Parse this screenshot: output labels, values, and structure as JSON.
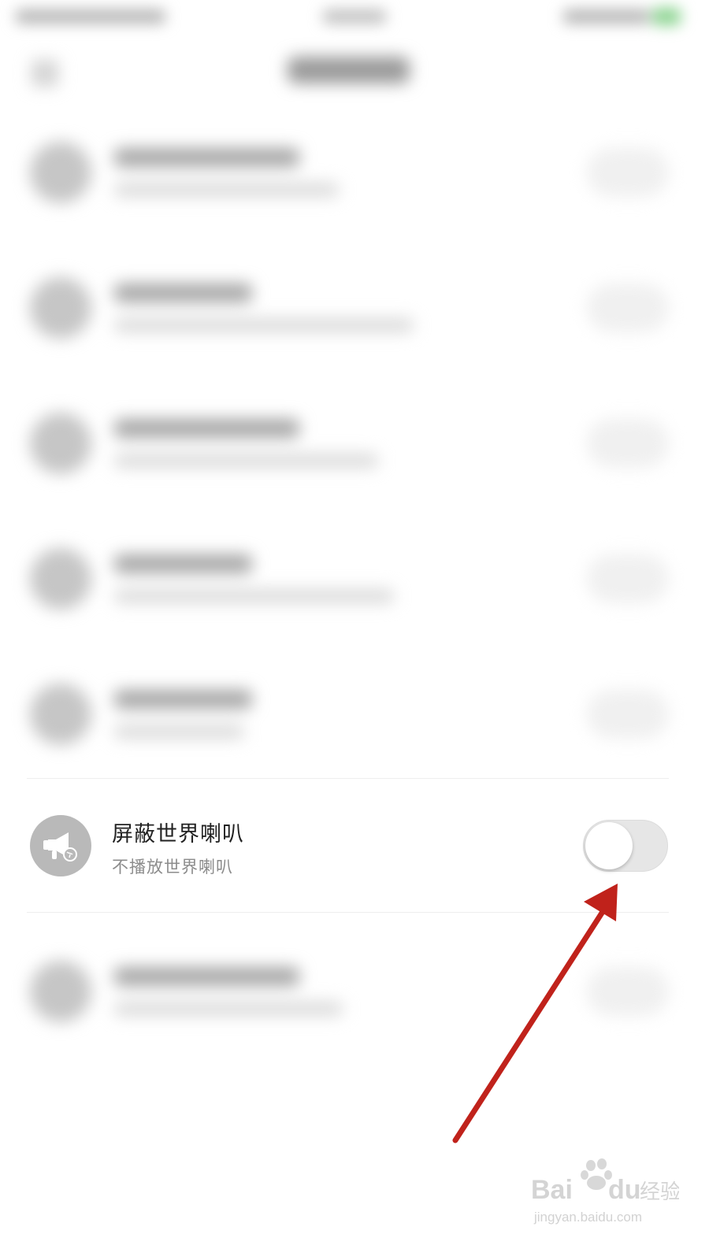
{
  "colors": {
    "background": "#ffffff",
    "title_text": "#222222",
    "subtitle_text": "#8c8c8c",
    "icon_circle": "#b9b9b9",
    "toggle_track_off": "#e6e6e6",
    "annotation_arrow": "#c0221b"
  },
  "focused_setting": {
    "icon": "megaphone-icon",
    "title": "屏蔽世界喇叭",
    "subtitle": "不播放世界喇叭",
    "toggle_on": false
  },
  "blurred_rows_count": 6,
  "watermark": {
    "logo": "Baidu经验",
    "url": "jingyan.baidu.com"
  }
}
